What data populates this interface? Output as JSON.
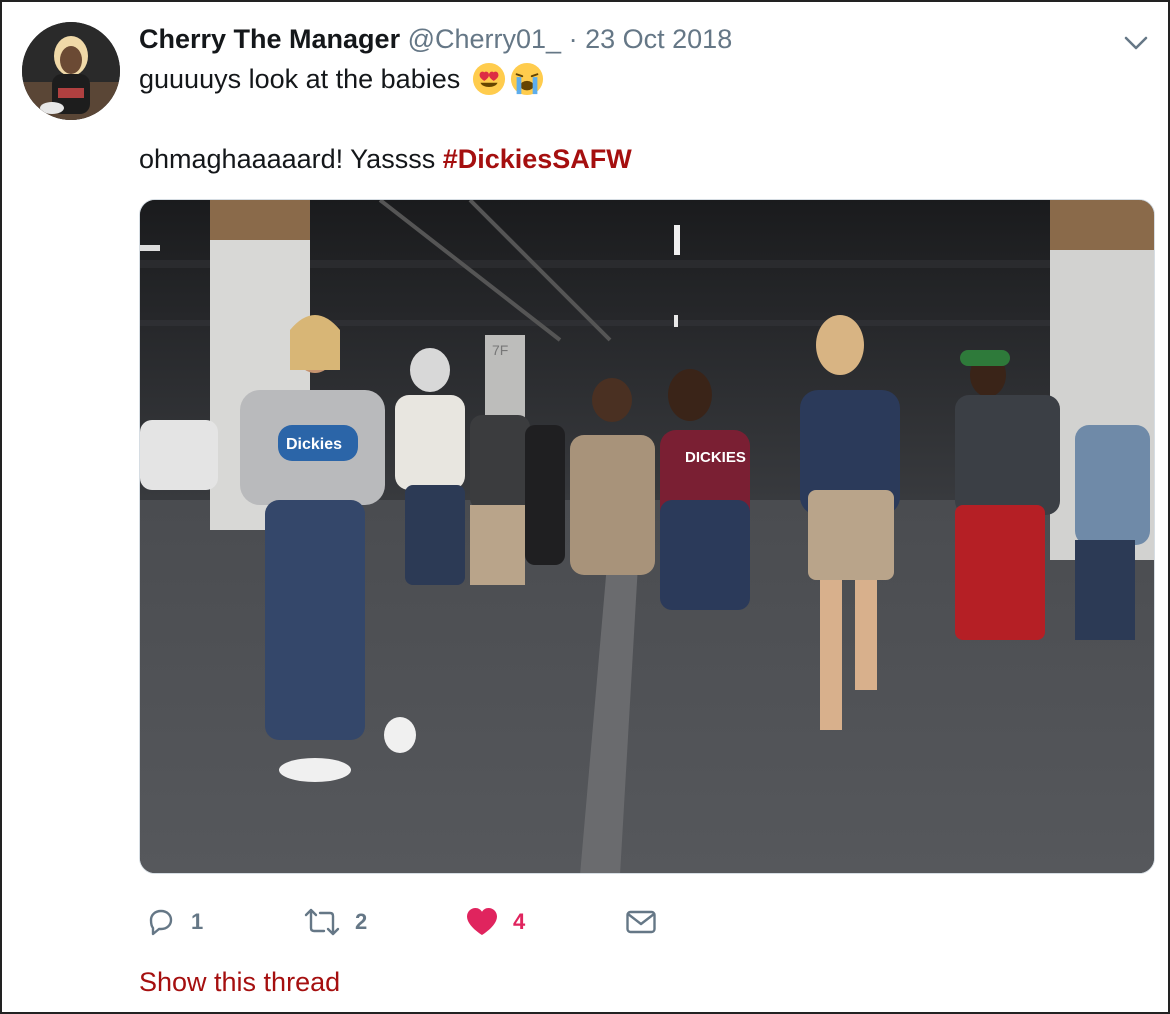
{
  "tweet": {
    "display_name": "Cherry The Manager",
    "handle": "@Cherry01_",
    "separator": "·",
    "date": "23 Oct 2018",
    "text_line1": "guuuuys look at the babies",
    "emojis": [
      "heart-eyes-emoji",
      "loudly-crying-emoji"
    ],
    "text_line2_prefix": "ohmaghaaaaard! Yassss ",
    "hashtag": "#DickiesSAFW",
    "image": {
      "description_icon": "group-photo",
      "shirt_logo_text": "Dickies",
      "shirt_print_text": "DICKIES",
      "pillar_label": "7F"
    }
  },
  "actions": {
    "reply": {
      "icon": "reply-icon",
      "count": "1"
    },
    "retweet": {
      "icon": "retweet-icon",
      "count": "2"
    },
    "like": {
      "icon": "heart-icon",
      "count": "4",
      "color": "#e0245e"
    },
    "message": {
      "icon": "envelope-icon"
    }
  },
  "show_thread": "Show this thread",
  "colors": {
    "hashtag": "#a50f0f",
    "muted": "#657786",
    "like": "#e0245e"
  }
}
